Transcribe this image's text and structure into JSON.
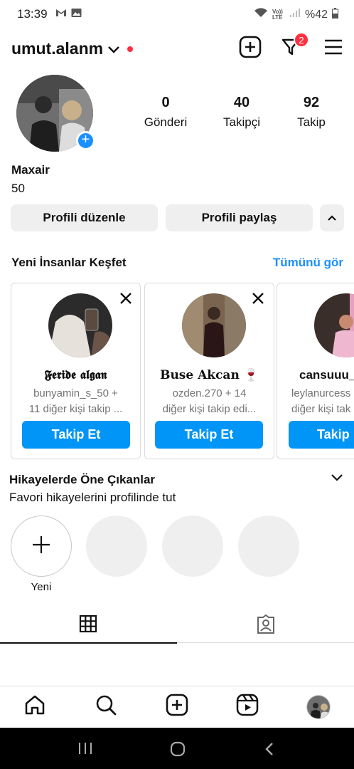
{
  "status_bar": {
    "time": "13:39",
    "network_label": "Vo)) LTE",
    "battery": "%42"
  },
  "header": {
    "username": "umut.alanm",
    "activity_badge_count": "2"
  },
  "profile": {
    "stats": [
      {
        "value": "0",
        "label": "Gönderi"
      },
      {
        "value": "40",
        "label": "Takipçi"
      },
      {
        "value": "92",
        "label": "Takip"
      }
    ],
    "name": "Maxair",
    "bio": "50",
    "edit_button": "Profili düzenle",
    "share_button": "Profili paylaş"
  },
  "discover": {
    "title": "Yeni İnsanlar Keşfet",
    "see_all": "Tümünü gör",
    "cards": [
      {
        "name": "𝕱𝖊𝖗𝖎𝖉𝖊 𝖆𝖑𝖌𝖆𝖓",
        "line1": "bunyamin_s_50 +",
        "line2": "11 diğer kişi takip ...",
        "button": "Takip Et"
      },
      {
        "name": "Buse Akcan 🍷",
        "line1": "ozden.270 + 14",
        "line2": "diğer kişi takip edi...",
        "button": "Takip Et"
      },
      {
        "name": "cansuuu_",
        "line1": "leylanurcess",
        "line2": "diğer kişi tak",
        "button": "Takip"
      }
    ]
  },
  "highlights": {
    "title": "Hikayelerde Öne Çıkanlar",
    "subtitle": "Favori hikayelerini profilinde tut",
    "new_label": "Yeni"
  },
  "colors": {
    "accent": "#0095f6",
    "link": "#1a8fff",
    "badge": "#ff3040",
    "button_gray": "#efefef"
  }
}
